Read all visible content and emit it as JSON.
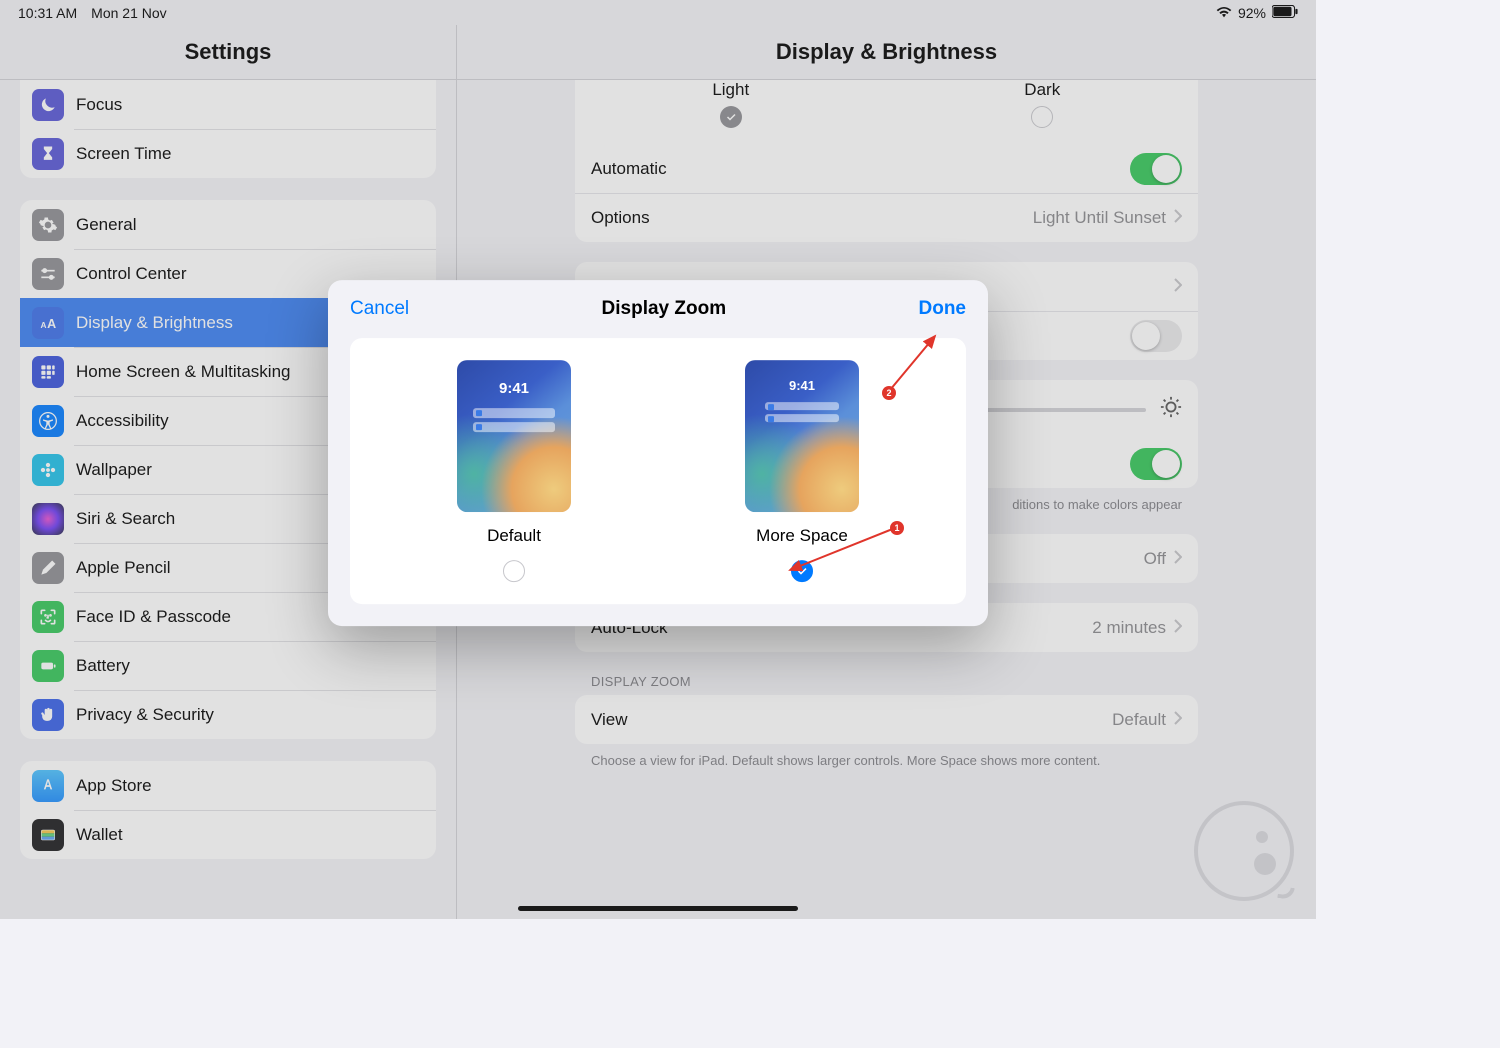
{
  "status": {
    "time": "10:31 AM",
    "date": "Mon 21 Nov",
    "battery": "92%"
  },
  "sidebar": {
    "title": "Settings",
    "group0": {
      "focus": "Focus",
      "screentime": "Screen Time"
    },
    "group1": {
      "general": "General",
      "control": "Control Center",
      "display": "Display & Brightness",
      "home": "Home Screen & Multitasking",
      "accessibility": "Accessibility",
      "wallpaper": "Wallpaper",
      "siri": "Siri & Search",
      "pencil": "Apple Pencil",
      "faceid": "Face ID & Passcode",
      "battery": "Battery",
      "privacy": "Privacy & Security"
    },
    "group2": {
      "appstore": "App Store",
      "wallet": "Wallet"
    }
  },
  "main": {
    "title": "Display & Brightness",
    "appearance": {
      "light": "Light",
      "dark": "Dark"
    },
    "automatic": "Automatic",
    "options_label": "Options",
    "options_value": "Light Until Sunset",
    "truetone_footer": "ditions to make colors appear",
    "nightshift_value": "Off",
    "autolock_label": "Auto-Lock",
    "autolock_value": "2 minutes",
    "zoom_header": "DISPLAY ZOOM",
    "view_label": "View",
    "view_value": "Default",
    "view_footer": "Choose a view for iPad. Default shows larger controls. More Space shows more content."
  },
  "modal": {
    "cancel": "Cancel",
    "title": "Display Zoom",
    "done": "Done",
    "default_label": "Default",
    "more_label": "More Space",
    "preview_time": "9:41"
  },
  "annotations": {
    "one": "1",
    "two": "2"
  },
  "colors": {
    "focus": "#5856d6",
    "screentime": "#5856d6",
    "general": "#8e8e93",
    "control": "#8e8e93",
    "display": "#3478f6",
    "home": "#3355e6",
    "accessibility": "#007aff",
    "wallpaper": "#17c1e8",
    "siri": "#1c1c1e",
    "pencil": "#8e8e93",
    "faceid": "#34c759",
    "battery": "#34c759",
    "privacy": "#3861e8",
    "appstore": "#1e8fff",
    "wallet": "#1c1c1e"
  }
}
